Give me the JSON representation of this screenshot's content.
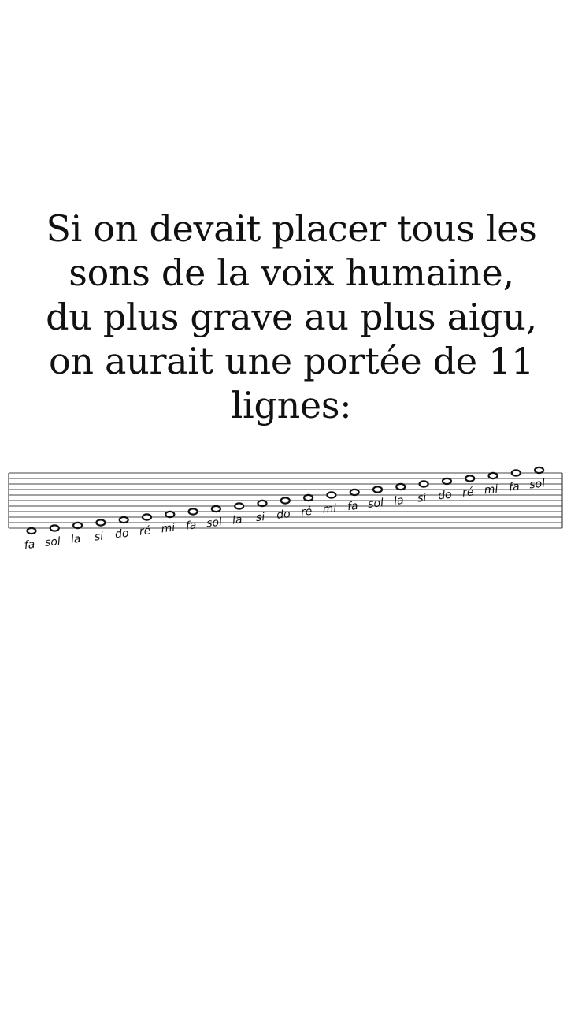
{
  "caption": {
    "lines": [
      "Si on devait placer tous les",
      "sons de la voix humaine,",
      "du plus grave au plus aigu,",
      "on aurait une portée de 11",
      "lignes:"
    ]
  },
  "staff": {
    "line_count": 11,
    "notes": [
      "fa",
      "sol",
      "la",
      "si",
      "do",
      "ré",
      "mi",
      "fa",
      "sol",
      "la",
      "si",
      "do",
      "ré",
      "mi",
      "fa",
      "sol",
      "la",
      "si",
      "do",
      "ré",
      "mi",
      "fa",
      "sol"
    ],
    "colors": {
      "ink": "#111111",
      "staff_line": "#444444"
    }
  }
}
